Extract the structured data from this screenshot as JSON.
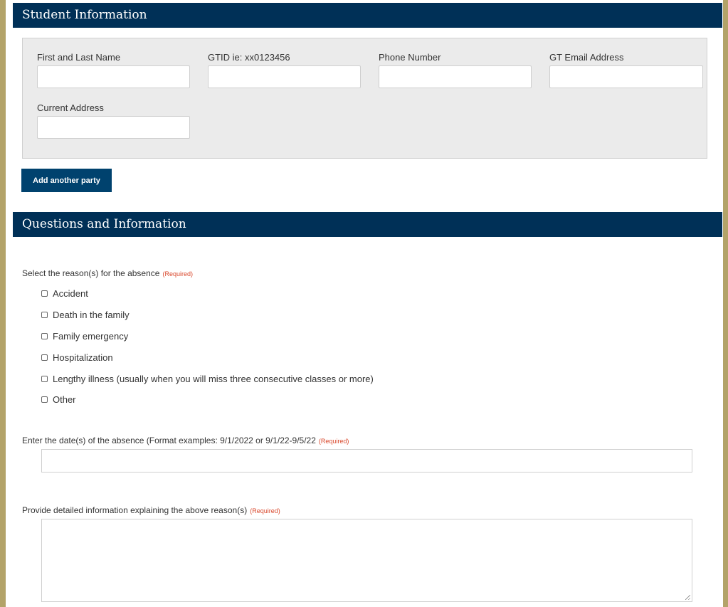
{
  "student_section": {
    "title": "Student Information",
    "fields": {
      "name_label": "First and Last Name",
      "gtid_label": "GTID ie: xx0123456",
      "phone_label": "Phone Number",
      "email_label": "GT Email Address",
      "address_label": "Current Address"
    },
    "add_party_label": "Add another party"
  },
  "questions_section": {
    "title": "Questions and Information",
    "reason_label": "Select the reason(s) for the absence",
    "required_label": "(Required)",
    "reasons": [
      "Accident",
      "Death in the family",
      "Family emergency",
      "Hospitalization",
      "Lengthy illness (usually when you will miss three consecutive classes or more)",
      "Other"
    ],
    "dates_label": "Enter the date(s) of the absence (Format examples: 9/1/2022 or 9/1/22-9/5/22",
    "details_label": "Provide detailed information explaining the above reason(s)"
  }
}
